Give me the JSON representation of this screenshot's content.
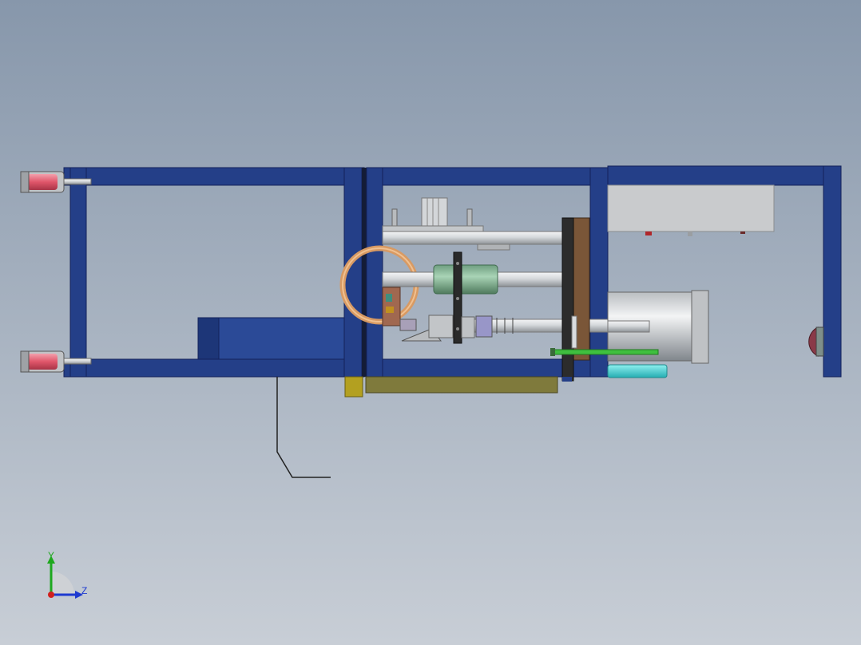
{
  "view": {
    "background_top": "#8797ab",
    "background_bottom": "#c8ced6"
  },
  "colors": {
    "frame": "#243f88",
    "frame_dark": "#1a2e66",
    "steel": "#d9dcdf",
    "copper": "#d89a63",
    "green_part": "#86b89a",
    "brown_plate": "#7a5638",
    "olive_plate": "#8a8244",
    "yellow_block": "#b8aa2a",
    "cyan_rod": "#3fd3d6",
    "maroon_knob": "#8a3a48",
    "red_cap": "#e56a7c"
  },
  "triad": {
    "y_label": "Y",
    "z_label": "Z",
    "y_color": "#1ea81e",
    "z_color": "#1e3ad0",
    "x_color": "#d0201e"
  }
}
